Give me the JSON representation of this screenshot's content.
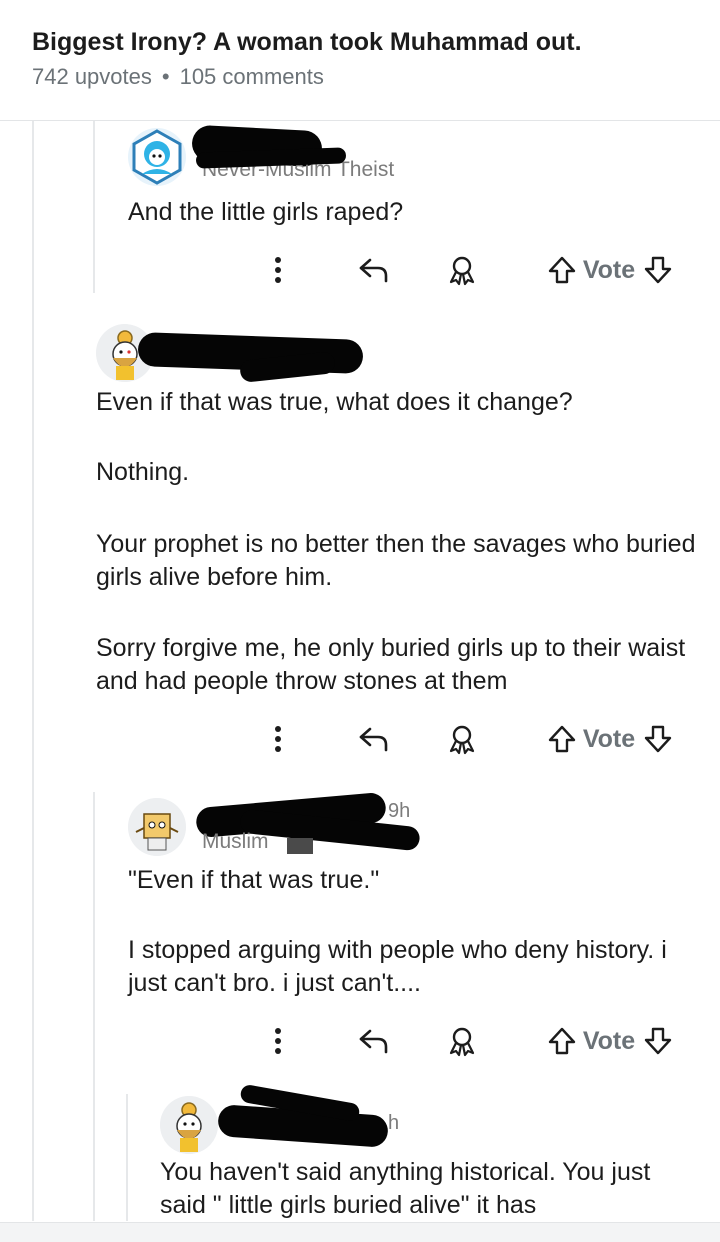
{
  "post": {
    "title": "Biggest Irony? A woman took Muhammad out.",
    "upvotes": "742 upvotes",
    "separator": "•",
    "comments": "105 comments"
  },
  "comments": [
    {
      "flair": "Never-Muslim Theist",
      "paragraphs": [
        "And the little girls raped?"
      ]
    },
    {
      "paragraphs": [
        "Even if that was true, what does it change?",
        "Nothing.",
        "Your prophet is no better then the savages who buried girls alive before him.",
        "Sorry forgive me, he only buried girls up to their waist and   had people throw stones at them"
      ]
    },
    {
      "flair": "Muslim",
      "time": "9h",
      "paragraphs": [
        "\"Even if that was true.\"",
        "I stopped arguing with people who deny history. i just can't bro. i just can't...."
      ]
    },
    {
      "time": "h",
      "paragraphs": [
        "You haven't said anything historical. You just said \" little girls buried alive\" it has"
      ]
    }
  ],
  "actions": {
    "vote_label": "Vote",
    "icons": [
      "more-options-icon",
      "reply-icon",
      "award-icon",
      "upvote-icon",
      "downvote-icon"
    ]
  },
  "colors": {
    "text": "#1c1c1c",
    "meta": "#6b7277",
    "thread_line": "#e6e8ea",
    "redaction": "#050505"
  }
}
